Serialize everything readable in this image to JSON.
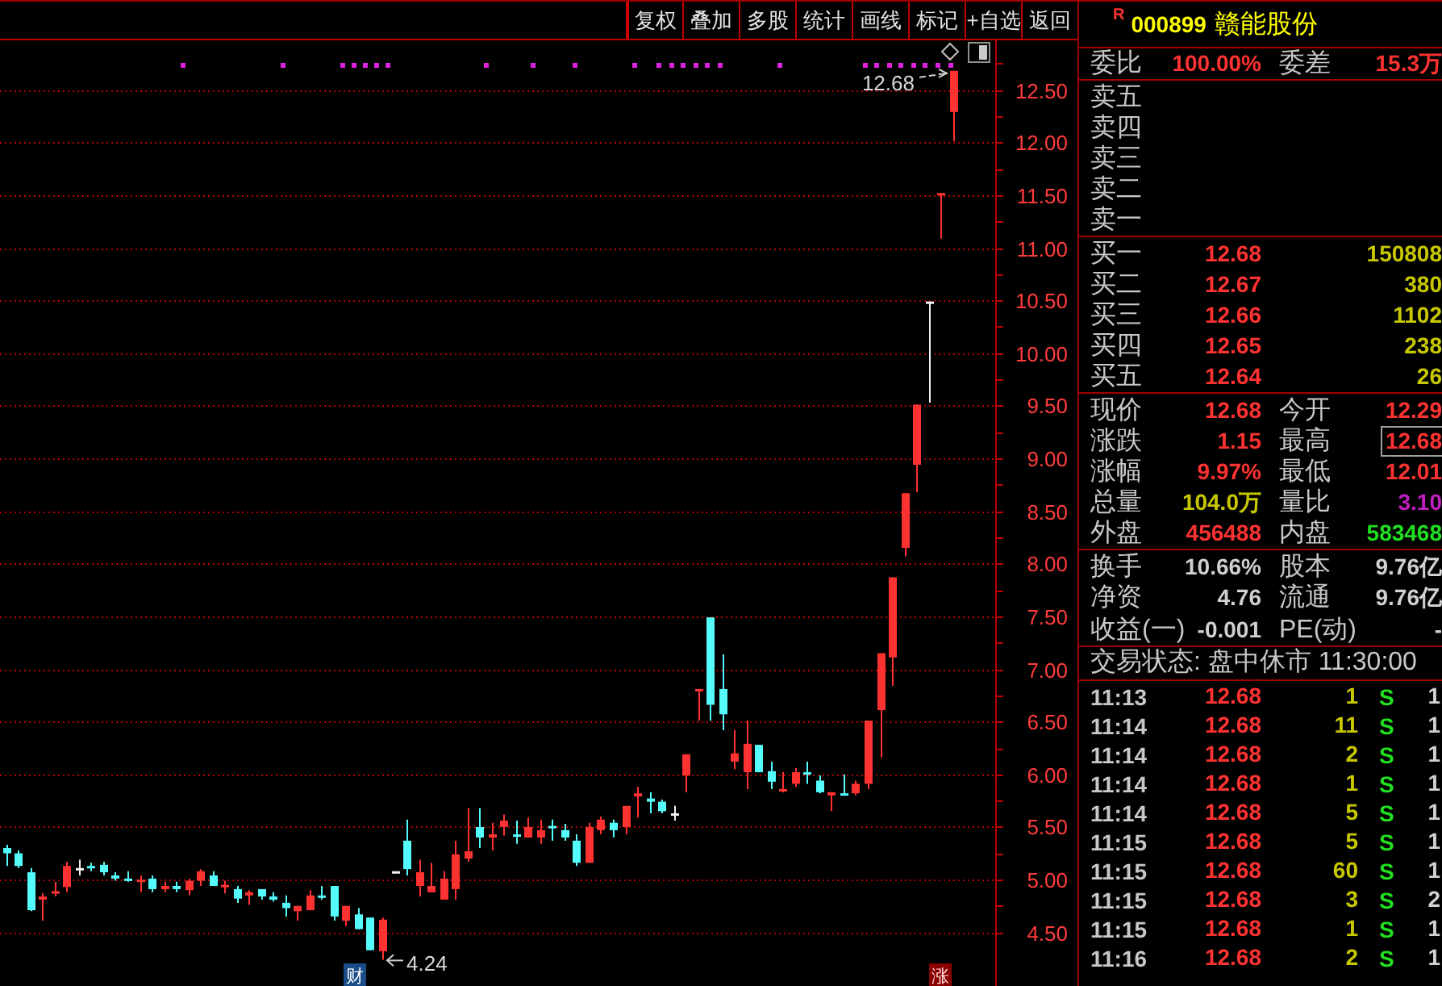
{
  "toolbar": {
    "buttons": [
      "复权",
      "叠加",
      "多股",
      "统计",
      "画线",
      "标记",
      "+自选",
      "返回"
    ]
  },
  "chart": {
    "chart_data": {
      "type": "candlestick",
      "ohlc": [
        [
          5.3,
          5.33,
          5.13,
          5.25
        ],
        [
          5.25,
          5.28,
          5.11,
          5.13
        ],
        [
          5.07,
          5.11,
          4.7,
          4.71
        ],
        [
          4.81,
          4.87,
          4.61,
          4.84
        ],
        [
          4.88,
          4.98,
          4.84,
          4.89
        ],
        [
          4.93,
          5.17,
          4.88,
          5.13
        ],
        [
          5.11,
          5.19,
          5.04,
          5.11
        ],
        [
          5.13,
          5.16,
          5.08,
          5.11
        ],
        [
          5.14,
          5.17,
          5.04,
          5.07
        ],
        [
          5.04,
          5.07,
          4.99,
          5.01
        ],
        [
          5.01,
          5.08,
          4.98,
          5.0
        ],
        [
          4.99,
          5.04,
          4.88,
          5.0
        ],
        [
          5.01,
          5.04,
          4.88,
          4.91
        ],
        [
          4.91,
          4.98,
          4.88,
          4.94
        ],
        [
          4.94,
          4.98,
          4.88,
          4.91
        ],
        [
          4.9,
          5.01,
          4.85,
          4.99
        ],
        [
          4.99,
          5.1,
          4.94,
          5.08
        ],
        [
          5.04,
          5.08,
          4.94,
          4.94
        ],
        [
          4.94,
          4.99,
          4.87,
          4.95
        ],
        [
          4.91,
          4.94,
          4.78,
          4.82
        ],
        [
          4.85,
          4.9,
          4.76,
          4.88
        ],
        [
          4.91,
          4.91,
          4.81,
          4.84
        ],
        [
          4.84,
          4.88,
          4.79,
          4.81
        ],
        [
          4.78,
          4.85,
          4.65,
          4.73
        ],
        [
          4.7,
          4.75,
          4.61,
          4.75
        ],
        [
          4.71,
          4.9,
          4.71,
          4.85
        ],
        [
          4.85,
          4.94,
          4.81,
          4.84
        ],
        [
          4.94,
          4.94,
          4.61,
          4.65
        ],
        [
          4.61,
          4.75,
          4.56,
          4.75
        ],
        [
          4.67,
          4.73,
          4.53,
          4.53
        ],
        [
          4.64,
          4.64,
          4.33,
          4.33
        ],
        [
          4.32,
          4.64,
          4.24,
          4.62
        ],
        [
          5.08,
          5.08,
          5.08,
          5.08
        ],
        [
          5.37,
          5.57,
          5.04,
          5.1
        ],
        [
          4.94,
          5.19,
          4.84,
          5.07
        ],
        [
          4.88,
          5.16,
          4.88,
          4.94
        ],
        [
          4.81,
          5.08,
          4.81,
          5.01
        ],
        [
          4.91,
          5.37,
          4.81,
          5.24
        ],
        [
          5.2,
          5.68,
          5.17,
          5.27
        ],
        [
          5.5,
          5.68,
          5.3,
          5.4
        ],
        [
          5.4,
          5.54,
          5.28,
          5.43
        ],
        [
          5.5,
          5.62,
          5.42,
          5.56
        ],
        [
          5.43,
          5.56,
          5.34,
          5.42
        ],
        [
          5.4,
          5.59,
          5.4,
          5.5
        ],
        [
          5.4,
          5.57,
          5.34,
          5.47
        ],
        [
          5.51,
          5.57,
          5.37,
          5.5
        ],
        [
          5.47,
          5.53,
          5.37,
          5.4
        ],
        [
          5.37,
          5.43,
          5.13,
          5.16
        ],
        [
          5.16,
          5.54,
          5.16,
          5.5
        ],
        [
          5.47,
          5.6,
          5.43,
          5.57
        ],
        [
          5.54,
          5.57,
          5.4,
          5.47
        ],
        [
          5.5,
          5.7,
          5.43,
          5.7
        ],
        [
          5.79,
          5.88,
          5.59,
          5.82
        ],
        [
          5.77,
          5.83,
          5.63,
          5.74
        ],
        [
          5.74,
          5.76,
          5.63,
          5.65
        ],
        [
          5.63,
          5.7,
          5.56,
          5.63
        ],
        [
          5.99,
          6.19,
          5.83,
          6.19
        ],
        [
          6.8,
          6.81,
          6.51,
          6.81
        ],
        [
          7.49,
          7.49,
          6.51,
          6.66
        ],
        [
          6.81,
          7.14,
          6.42,
          6.57
        ],
        [
          6.12,
          6.42,
          6.05,
          6.2
        ],
        [
          6.02,
          6.51,
          5.86,
          6.29
        ],
        [
          6.28,
          6.28,
          6.02,
          6.02
        ],
        [
          6.03,
          6.12,
          5.86,
          5.93
        ],
        [
          5.85,
          6.02,
          5.83,
          5.86
        ],
        [
          5.91,
          6.06,
          5.88,
          6.02
        ],
        [
          6.02,
          6.12,
          5.91,
          6.01
        ],
        [
          5.94,
          5.99,
          5.82,
          5.83
        ],
        [
          5.8,
          5.83,
          5.65,
          5.83
        ],
        [
          5.82,
          6.0,
          5.8,
          5.81
        ],
        [
          5.82,
          5.94,
          5.8,
          5.91
        ],
        [
          5.91,
          6.51,
          5.86,
          6.51
        ],
        [
          6.61,
          7.15,
          6.16,
          7.15
        ],
        [
          7.11,
          7.87,
          6.84,
          7.87
        ],
        [
          8.15,
          8.67,
          8.07,
          8.67
        ],
        [
          8.94,
          9.51,
          8.68,
          9.51
        ],
        [
          10.49,
          10.49,
          9.53,
          10.49
        ],
        [
          11.51,
          11.52,
          11.09,
          11.52
        ],
        [
          12.29,
          12.68,
          12.01,
          12.68
        ],
        null,
        null,
        null
      ],
      "ylim": [
        3.99,
        12.97
      ],
      "yticks": [
        {
          "value": 12.5,
          "label": "12.50"
        },
        {
          "value": 12,
          "label": "12.00"
        },
        {
          "value": 11.5,
          "label": "11.50"
        },
        {
          "value": 11,
          "label": "11.00"
        },
        {
          "value": 10.5,
          "label": "10.50"
        },
        {
          "value": 10,
          "label": "10.00"
        },
        {
          "value": 9.5,
          "label": "9.50"
        },
        {
          "value": 9,
          "label": "9.00"
        },
        {
          "value": 8.5,
          "label": "8.50"
        },
        {
          "value": 8,
          "label": "8.00"
        },
        {
          "value": 7.5,
          "label": "7.50"
        },
        {
          "value": 7,
          "label": "7.00"
        },
        {
          "value": 6.5,
          "label": "6.50"
        },
        {
          "value": 6,
          "label": "6.00"
        },
        {
          "value": 5.5,
          "label": "5.50"
        },
        {
          "value": 5,
          "label": "5.00"
        },
        {
          "value": 4.5,
          "label": "4.50"
        }
      ],
      "grid": true
    },
    "high_label": "12.68",
    "low_label": "4.24",
    "tags": [
      {
        "kind": "finance",
        "text": "财"
      },
      {
        "kind": "limit_up",
        "text": "涨"
      }
    ]
  },
  "quote": {
    "flag": "R",
    "code": "000899",
    "name": "赣能股份",
    "summary": [
      {
        "label": "委比",
        "value": "100.00%"
      },
      {
        "label": "委差",
        "value": "15.3万"
      }
    ],
    "asks": [
      {
        "label": "卖五"
      },
      {
        "label": "卖四"
      },
      {
        "label": "卖三"
      },
      {
        "label": "卖二"
      },
      {
        "label": "卖一"
      }
    ],
    "bids": [
      {
        "label": "买一",
        "price": "12.68",
        "volume": "150808"
      },
      {
        "label": "买二",
        "price": "12.67",
        "volume": "380"
      },
      {
        "label": "买三",
        "price": "12.66",
        "volume": "1102"
      },
      {
        "label": "买四",
        "price": "12.65",
        "volume": "238"
      },
      {
        "label": "买五",
        "price": "12.64",
        "volume": "26"
      }
    ],
    "stats": [
      {
        "label": "现价",
        "value": "12.68",
        "color": "#ff3232",
        "highlighted": false
      },
      {
        "label": "今开",
        "value": "12.29",
        "color": "#ff3232",
        "highlighted": false
      },
      {
        "label": "涨跌",
        "value": "1.15",
        "color": "#ff3232",
        "highlighted": false
      },
      {
        "label": "最高",
        "value": "12.68",
        "color": "#ff3232",
        "highlighted": true
      },
      {
        "label": "涨幅",
        "value": "9.97%",
        "color": "#ff3232",
        "highlighted": false
      },
      {
        "label": "最低",
        "value": "12.01",
        "color": "#ff3232",
        "highlighted": false
      },
      {
        "label": "总量",
        "value": "104.0万",
        "color": "#c8c800",
        "highlighted": false
      },
      {
        "label": "量比",
        "value": "3.10",
        "color": "#c020c0",
        "highlighted": false
      },
      {
        "label": "外盘",
        "value": "456488",
        "color": "#ff3232",
        "highlighted": false
      },
      {
        "label": "内盘",
        "value": "583468",
        "color": "#20e020",
        "highlighted": false
      }
    ],
    "fundamentals": [
      {
        "label": "换手",
        "value": "10.66%"
      },
      {
        "label": "股本",
        "value": "9.76亿"
      },
      {
        "label": "净资",
        "value": "4.76"
      },
      {
        "label": "流通",
        "value": "9.76亿"
      },
      {
        "label": "收益(一)",
        "value": "-0.001"
      },
      {
        "label": "PE(动)",
        "value": "-"
      }
    ],
    "trading_status": "交易状态: 盘中休市 11:30:00"
  },
  "trades": {
    "rows": [
      {
        "time": "11:13",
        "price": "12.68",
        "volume": "1",
        "side": "S",
        "column_5": "1"
      },
      {
        "time": "11:14",
        "price": "12.68",
        "volume": "11",
        "side": "S",
        "column_5": "1"
      },
      {
        "time": "11:14",
        "price": "12.68",
        "volume": "2",
        "side": "S",
        "column_5": "1"
      },
      {
        "time": "11:14",
        "price": "12.68",
        "volume": "1",
        "side": "S",
        "column_5": "1"
      },
      {
        "time": "11:14",
        "price": "12.68",
        "volume": "5",
        "side": "S",
        "column_5": "1"
      },
      {
        "time": "11:15",
        "price": "12.68",
        "volume": "5",
        "side": "S",
        "column_5": "1"
      },
      {
        "time": "11:15",
        "price": "12.68",
        "volume": "60",
        "side": "S",
        "column_5": "1"
      },
      {
        "time": "11:15",
        "price": "12.68",
        "volume": "3",
        "side": "S",
        "column_5": "2"
      },
      {
        "time": "11:15",
        "price": "12.68",
        "volume": "1",
        "side": "S",
        "column_5": "1"
      },
      {
        "time": "11:16",
        "price": "12.68",
        "volume": "2",
        "side": "S",
        "column_5": "1"
      }
    ]
  }
}
